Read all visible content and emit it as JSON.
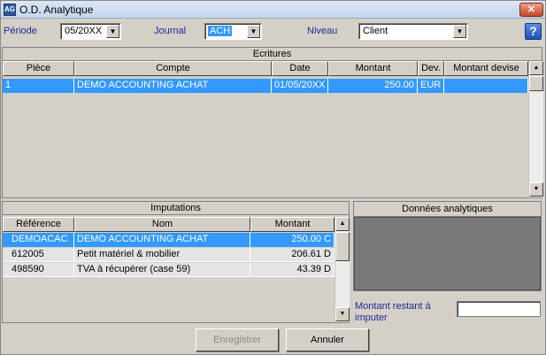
{
  "window": {
    "title": "O.D. Analytique",
    "app_icon": "AG",
    "close_glyph": "✕"
  },
  "filters": {
    "periode_label": "Période",
    "periode_value": "05/20XX",
    "journal_label": "Journal",
    "journal_value": "ACH",
    "niveau_label": "Niveau",
    "niveau_value": "Client",
    "help_glyph": "?"
  },
  "ecritures": {
    "title": "Ecritures",
    "columns": [
      "Pièce",
      "Compte",
      "Date",
      "Montant",
      "Dev.",
      "Montant devise"
    ],
    "rows": [
      {
        "piece": "1",
        "compte": "DEMO ACCOUNTING ACHAT",
        "date": "01/05/20XX",
        "montant": "250.00",
        "dev": "EUR",
        "montant_devise": ""
      }
    ]
  },
  "imputations": {
    "title": "Imputations",
    "columns": [
      "Référence",
      "Nom",
      "Montant"
    ],
    "rows": [
      {
        "reference": "DEMOACAC",
        "nom": "DEMO ACCOUNTING ACHAT",
        "montant": "250.00 C"
      },
      {
        "reference": "612005",
        "nom": "Petit matériel & mobilier",
        "montant": "206.61 D"
      },
      {
        "reference": "498590",
        "nom": "TVA à récupérer (case 59)",
        "montant": "43.39 D"
      }
    ]
  },
  "donnees": {
    "title": "Données analytiques"
  },
  "montant_restant": {
    "label_line1": "Montant restant à",
    "label_line2": "imputer",
    "value": ""
  },
  "buttons": {
    "enregistrer": "Enregistrer",
    "annuler": "Annuler"
  },
  "icons": {
    "scroll_up": "▲",
    "scroll_down": "▼",
    "dropdown": "▼"
  }
}
